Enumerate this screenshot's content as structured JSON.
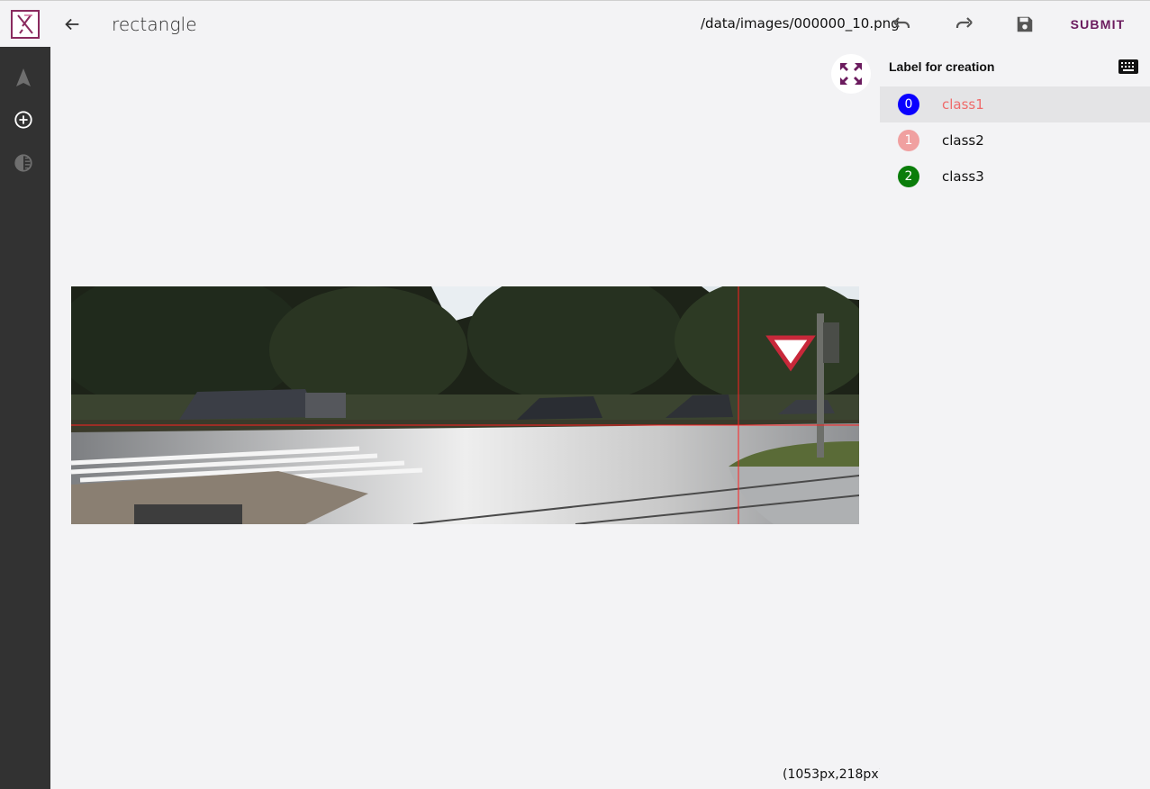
{
  "header": {
    "title": "rectangle",
    "file_path": "/data/images/000000_10.png",
    "submit_label": "SUBMIT",
    "icons": [
      "logo-icon",
      "arrow-left-icon",
      "undo-icon",
      "redo-icon",
      "save-icon"
    ],
    "accent_color": "#6b1b5e"
  },
  "tools": [
    {
      "name": "select-tool",
      "icon": "cursor-arrow-icon",
      "active": false
    },
    {
      "name": "add-tool",
      "icon": "plus-circle-icon",
      "active": true
    },
    {
      "name": "contrast-tool",
      "icon": "contrast-icon",
      "active": false
    }
  ],
  "canvas": {
    "coords_text": "(1053px,218px)",
    "fullscreen_icon": "fullscreen-icon"
  },
  "side_panel": {
    "title": "Label for creation",
    "keyboard_icon": "keyboard-icon",
    "labels": [
      {
        "index": "0",
        "name": "class1",
        "color": "#0a00ff",
        "selected": true
      },
      {
        "index": "1",
        "name": "class2",
        "color": "#f0a0a0",
        "selected": false
      },
      {
        "index": "2",
        "name": "class3",
        "color": "#0a7d0a",
        "selected": false
      }
    ]
  }
}
